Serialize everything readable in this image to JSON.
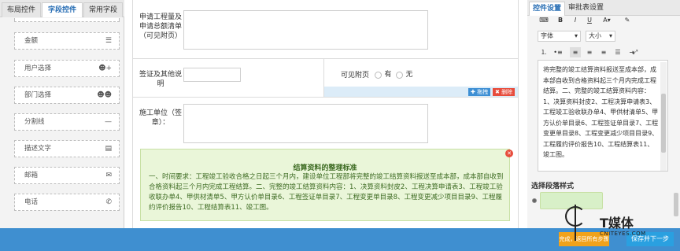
{
  "left_tabs": [
    "布局控件",
    "字段控件",
    "常用字段"
  ],
  "controls": [
    {
      "label": "金额",
      "icon": "database-icon",
      "glyph": "☰"
    },
    {
      "label": "用户选择",
      "icon": "add-user-icon",
      "glyph": "👤+"
    },
    {
      "label": "部门选择",
      "icon": "users-icon",
      "glyph": "👥"
    },
    {
      "label": "分割线",
      "icon": "minus-icon",
      "glyph": "—"
    },
    {
      "label": "描述文字",
      "icon": "text-icon",
      "glyph": "▤"
    },
    {
      "label": "邮箱",
      "icon": "mail-icon",
      "glyph": "✉"
    },
    {
      "label": "电话",
      "icon": "phone-icon",
      "glyph": "✆"
    }
  ],
  "form": {
    "field1_label": "申请工程量及申请总额清单（可见附页）",
    "field2_label": "签证及其他说明",
    "field3_label": "可见附页",
    "radio_yes": "有",
    "radio_no": "无",
    "drag_label": "✚ 拖拽",
    "delete_label": "✖ 删除",
    "field4_label": "施工单位（签章）："
  },
  "info": {
    "title": "结算资料的整理标准",
    "body": "一、时间要求：工程竣工验收合格之日起三个月内，建设单位工程部将完整的竣工结算资料报送至成本部，成本部自收到合格资料起三个月内完成工程结算。二、完整的竣工结算资料内容：1、决算资料封皮2、工程决算申请表3、工程竣工验收联办单4、甲供材清单5、甲方认价单目录6、工程签证单目录7、工程变更单目录8、工程变更减少项目目录9、工程履约评价报告10、工程结算表11、竣工图。"
  },
  "right_tabs": [
    "控件设置",
    "审批表设置"
  ],
  "toolbar": {
    "font_label": "字体",
    "size_label": "大小"
  },
  "editor_text": "将完整的竣工结算资料报送至成本部，成本部自收到合格资料起三个月内完成工程结算。二、完整的竣工结算资料内容：1、决算资料封皮2、工程决算申请表3、工程竣工验收联办单4、甲供材清单5、甲方认价单目录6、工程签证单目录7、工程变更单目录8、工程变更减少项目目录9、工程履约评价报告10、工程结算表11、竣工图。",
  "style_section_label": "选择段落样式",
  "footer": {
    "prev_label": "完成，返回所有步骤",
    "next_label": "保存并下一步"
  },
  "watermark": {
    "brand": "T媒体",
    "url": "CNITEYES.COM"
  },
  "colors": {
    "primary": "#3f8fd0",
    "accent_blue": "#2a6fb5",
    "delete_red": "#e74c3c",
    "drag_blue": "#3d8fd4",
    "info_bg": "#eaf6d9",
    "info_text": "#3d6b22",
    "footer_orange": "#f0a21b",
    "footer_cyan": "#2aa0e0"
  }
}
